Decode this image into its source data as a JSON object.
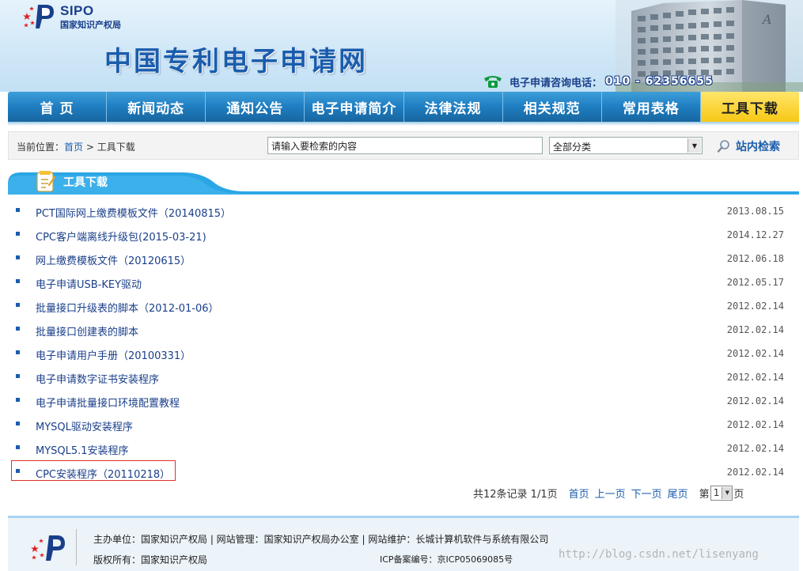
{
  "header": {
    "logo_text": "SIPO",
    "logo_subtitle": "国家知识产权局",
    "site_title": "中国专利电子申请网",
    "hotline_label": "电子申请咨询电话：",
    "hotline_number": "010 - 62356655"
  },
  "nav": {
    "items": [
      {
        "label": "首  页"
      },
      {
        "label": "新闻动态"
      },
      {
        "label": "通知公告"
      },
      {
        "label": "电子申请简介"
      },
      {
        "label": "法律法规"
      },
      {
        "label": "相关规范"
      },
      {
        "label": "常用表格"
      },
      {
        "label": "工具下载"
      }
    ],
    "active_index": 7
  },
  "breadcrumb": {
    "prefix": "当前位置：",
    "home": "首页",
    "separator": ">",
    "current": "工具下载"
  },
  "search": {
    "input_value": "请输入要检索的内容",
    "category_value": "全部分类",
    "button_label": "站内检索"
  },
  "section": {
    "title": "工具下载"
  },
  "downloads": [
    {
      "title": "PCT国际网上缴费模板文件（20140815）",
      "date": "2013.08.15"
    },
    {
      "title": "CPC客户端离线升级包(2015-03-21)",
      "date": "2014.12.27"
    },
    {
      "title": "网上缴费模板文件（20120615）",
      "date": "2012.06.18"
    },
    {
      "title": "电子申请USB-KEY驱动",
      "date": "2012.05.17"
    },
    {
      "title": "批量接口升级表的脚本（2012-01-06）",
      "date": "2012.02.14"
    },
    {
      "title": "批量接口创建表的脚本",
      "date": "2012.02.14"
    },
    {
      "title": "电子申请用户手册（20100331）",
      "date": "2012.02.14"
    },
    {
      "title": "电子申请数字证书安装程序",
      "date": "2012.02.14"
    },
    {
      "title": "电子申请批量接口环境配置教程",
      "date": "2012.02.14"
    },
    {
      "title": "MYSQL驱动安装程序",
      "date": "2012.02.14"
    },
    {
      "title": "MYSQL5.1安装程序",
      "date": "2012.02.14"
    },
    {
      "title": "CPC安装程序（20110218）",
      "date": "2012.02.14"
    }
  ],
  "pagination": {
    "summary": "共12条记录 1/1页",
    "first": "首页",
    "prev": "上一页",
    "next": "下一页",
    "last": "尾页",
    "page_prefix": "第",
    "page_value": "1",
    "page_suffix": "页"
  },
  "footer": {
    "line1": "主办单位：国家知识产权局 | 网站管理：国家知识产权局办公室 | 网站维护：长城计算机软件与系统有限公司",
    "line2": "版权所有：国家知识产权局",
    "icp": "ICP备案编号：京ICP05069085号"
  },
  "watermark": "http://blog.csdn.net/lisenyang",
  "colors": {
    "nav_blue": "#1f7dc1",
    "nav_active": "#f7c814",
    "link_blue": "#1a5dad",
    "highlight_red": "#e03030"
  }
}
